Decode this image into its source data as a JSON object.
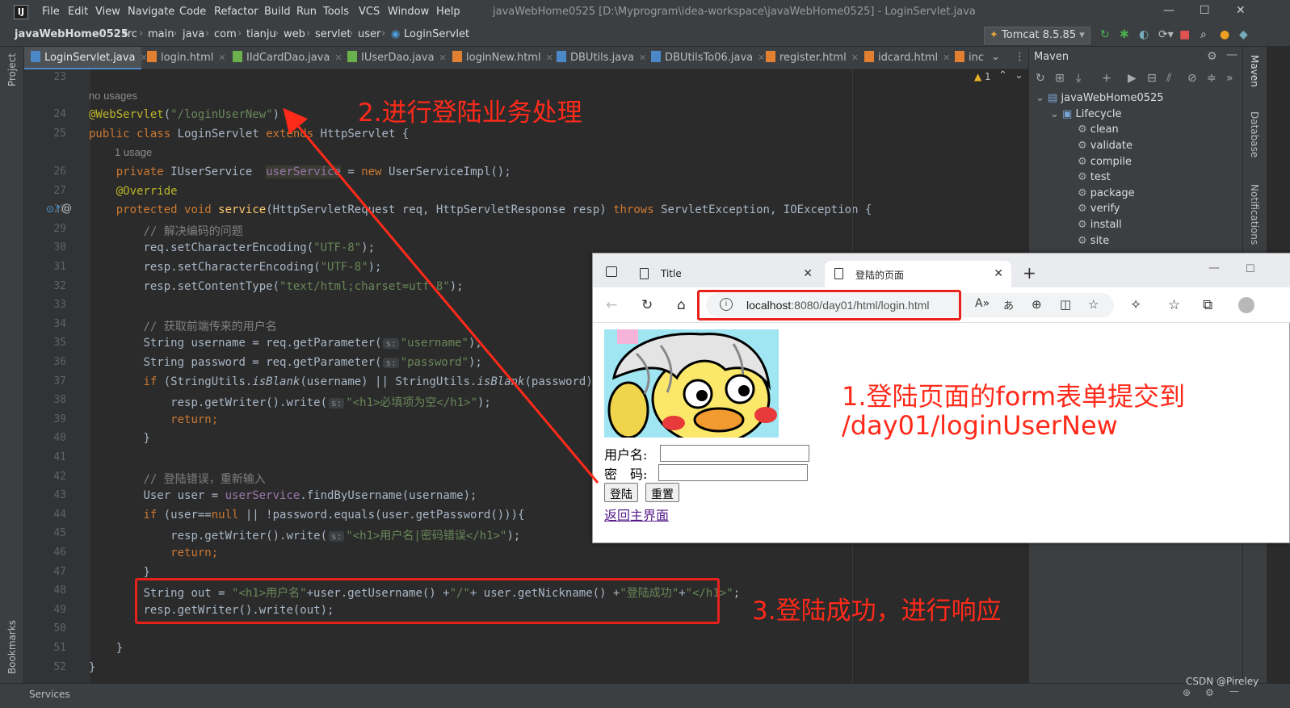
{
  "menu": {
    "items": [
      "File",
      "Edit",
      "View",
      "Navigate",
      "Code",
      "Refactor",
      "Build",
      "Run",
      "Tools",
      "VCS",
      "Window",
      "Help"
    ],
    "window_title": "javaWebHome0525 [D:\\Myprogram\\idea-workspace\\javaWebHome0525] - LoginServlet.java"
  },
  "breadcrumb": [
    "javaWebHome0525",
    "src",
    "main",
    "java",
    "com",
    "tianju",
    "web",
    "servlet",
    "user",
    "LoginServlet"
  ],
  "run_config": "Tomcat 8.5.85",
  "tabs": [
    "LoginServlet.java",
    "login.html",
    "IIdCardDao.java",
    "IUserDao.java",
    "loginNew.html",
    "DBUtils.java",
    "DBUtilsTo06.java",
    "register.html",
    "idcard.html",
    "inc"
  ],
  "left_strip": {
    "project": "Project",
    "bookmarks": "Bookmarks"
  },
  "right_strip": {
    "maven": "Maven",
    "database": "Database",
    "notifications": "Notifications"
  },
  "editor": {
    "warning_count": "1",
    "hints": {
      "no_usages": "no usages",
      "one_usage": "1 usage"
    },
    "line_numbers": [
      "23",
      "24",
      "25",
      "26",
      "27",
      "28",
      "29",
      "30",
      "31",
      "32",
      "33",
      "34",
      "35",
      "36",
      "37",
      "38",
      "39",
      "40",
      "41",
      "42",
      "43",
      "44",
      "45",
      "46",
      "47",
      "48",
      "49",
      "50",
      "51",
      "52"
    ],
    "lines": {
      "l24": {
        "annotation": "@WebServlet",
        "arg": "\"/loginUserNew\""
      },
      "l25": {
        "public": "public",
        "class": "class",
        "name": "LoginServlet",
        "extends": "extends",
        "parent": "HttpServlet {"
      },
      "l26": {
        "private": "private",
        "type": "IUserService",
        "field": "userService",
        "eq": " = ",
        "new": "new",
        "rest": "UserServiceImpl();"
      },
      "l27": {
        "text": "@Override"
      },
      "l28": {
        "protected": "protected",
        "void": "void",
        "method": "service",
        "params": "(HttpServletRequest req, HttpServletResponse resp)",
        "throws": "throws",
        "rest": "ServletException, IOException {"
      },
      "l29": {
        "text": "// 解决编码的问题"
      },
      "l30": {
        "pre": "req.setCharacterEncoding(",
        "str": "\"UTF-8\"",
        "post": ");"
      },
      "l31": {
        "pre": "resp.setCharacterEncoding(",
        "str": "\"UTF-8\"",
        "post": ");"
      },
      "l32": {
        "pre": "resp.setContentType(",
        "str": "\"text/html;charset=utf-8\"",
        "post": ");"
      },
      "l34": {
        "text": "// 获取前端传来的用户名"
      },
      "l35": {
        "pre": "String username = req.getParameter(",
        "hint": "s:",
        "str": "\"username\"",
        "post": ");"
      },
      "l36": {
        "pre": "String password = req.getParameter(",
        "hint": "s:",
        "str": "\"password\"",
        "post": ");"
      },
      "l37": {
        "if": "if",
        "a": " (StringUtils.",
        "m1": "isBlank",
        "b": "(username) || StringUtils.",
        "m2": "isBlank",
        "c": "(password)){"
      },
      "l38": {
        "pre": "resp.getWriter().write(",
        "hint": "s:",
        "str": "\"<h1>必填项为空</h1>\"",
        "post": ");"
      },
      "l39": {
        "text": "return;"
      },
      "l40": {
        "text": "}"
      },
      "l42": {
        "text": "// 登陆错误，重新输入"
      },
      "l43": {
        "pre": "User user = ",
        "field": "userService",
        "post": ".findByUsername(username);"
      },
      "l44": {
        "if": "if",
        "a": " (user==",
        "null": "null",
        "b": " || !password.equals(user.getPassword())){"
      },
      "l45": {
        "pre": "resp.getWriter().write(",
        "hint": "s:",
        "str": "\"<h1>用户名|密码错误</h1>\"",
        "post": ");"
      },
      "l46": {
        "text": "return;"
      },
      "l47": {
        "text": "}"
      },
      "l48": {
        "pre": "String out = ",
        "s1": "\"<h1>用户名\"",
        "m1": "+user.getUsername() +",
        "s2": "\"/\"",
        "m2": "+ user.getNickname() +",
        "s3": "\"登陆成功\"",
        "m3": "+",
        "s4": "\"</h1>\"",
        "post": ";"
      },
      "l49": {
        "text": "resp.getWriter().write(out);"
      },
      "l51": {
        "text": "}"
      },
      "l52": {
        "text": "}"
      }
    }
  },
  "maven": {
    "title": "Maven",
    "project": "javaWebHome0525",
    "lifecycle": "Lifecycle",
    "phases": [
      "clean",
      "validate",
      "compile",
      "test",
      "package",
      "verify",
      "install",
      "site"
    ]
  },
  "browser": {
    "tabs": [
      {
        "label": "Title"
      },
      {
        "label": "登陆的页面"
      }
    ],
    "url_host": "localhost",
    "url_rest": ":8080/day01/html/login.html",
    "form": {
      "username_label": "用户名:",
      "password_label": "密　码:",
      "login_button": "登陆",
      "reset_button": "重置",
      "back_link": "返回主界面"
    }
  },
  "annotations": {
    "step1_line1": "1.登陆页面的form表单提交到",
    "step1_line2": "/day01/loginUserNew",
    "step2": "2.进行登陆业务处理",
    "step3": "3.登陆成功，进行响应",
    "color": "#ff2a1a"
  },
  "status": {
    "services": "Services"
  },
  "watermark": "CSDN @Pireley"
}
